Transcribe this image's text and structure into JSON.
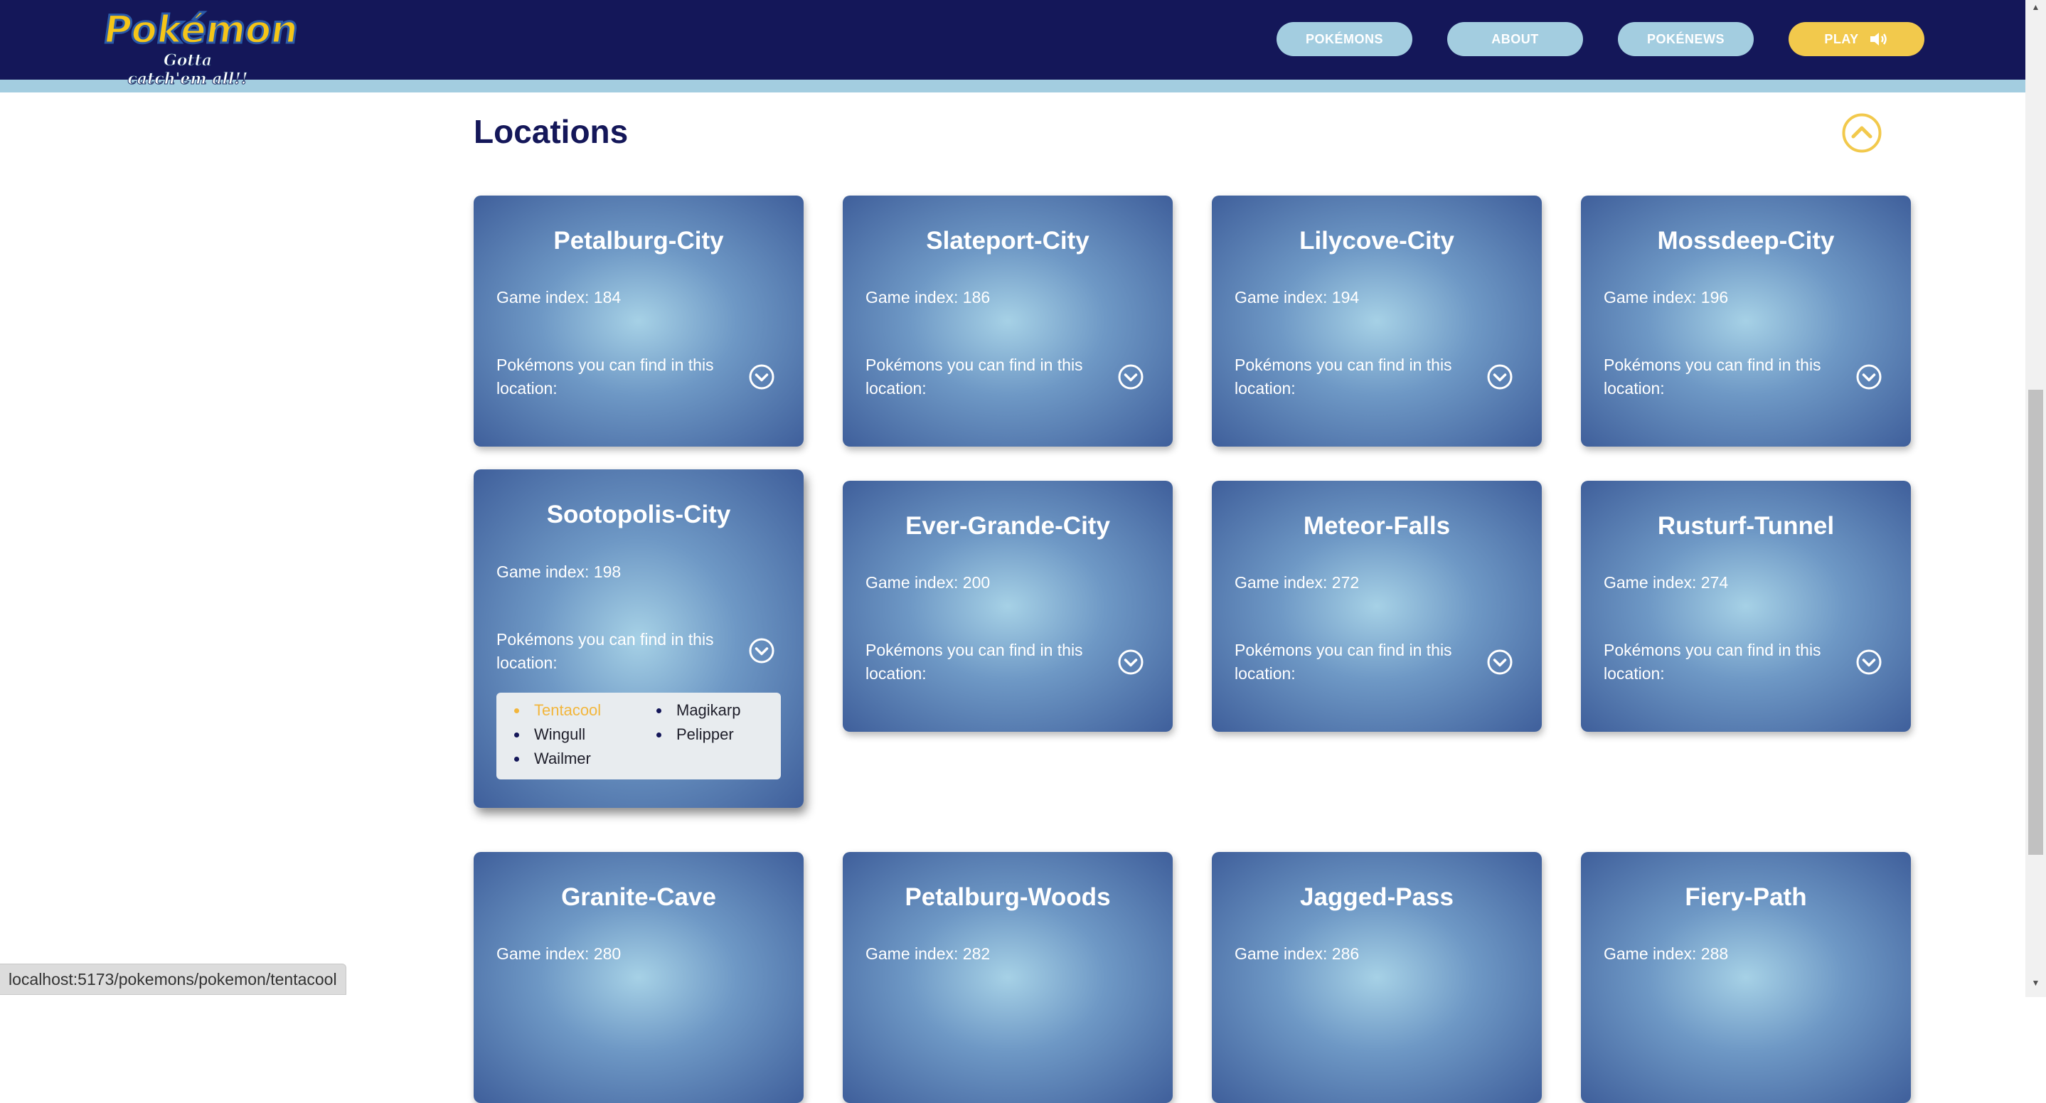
{
  "header": {
    "logo": {
      "wordmark": "Pokémon",
      "tagline": "Gotta catch'em all!!"
    },
    "nav": [
      {
        "label": "POKÉMONS"
      },
      {
        "label": "ABOUT"
      },
      {
        "label": "POKÉNEWS"
      },
      {
        "label": "PLAY",
        "icon": "speaker-icon"
      }
    ]
  },
  "section": {
    "title": "Locations"
  },
  "cards": [
    {
      "name": "Petalburg-City",
      "game_index": "Game index: 184",
      "find_text": "Pokémons you can find in this location:"
    },
    {
      "name": "Slateport-City",
      "game_index": "Game index: 186",
      "find_text": "Pokémons you can find in this location:"
    },
    {
      "name": "Lilycove-City",
      "game_index": "Game index: 194",
      "find_text": "Pokémons you can find in this location:"
    },
    {
      "name": "Mossdeep-City",
      "game_index": "Game index: 196",
      "find_text": "Pokémons you can find in this location:"
    },
    {
      "name": "Sootopolis-City",
      "game_index": "Game index: 198",
      "find_text": "Pokémons you can find in this location:",
      "expanded": true,
      "pokemons": [
        "Tentacool",
        "Magikarp",
        "Wingull",
        "Pelipper",
        "Wailmer"
      ]
    },
    {
      "name": "Ever-Grande-City",
      "game_index": "Game index: 200",
      "find_text": "Pokémons you can find in this location:"
    },
    {
      "name": "Meteor-Falls",
      "game_index": "Game index: 272",
      "find_text": "Pokémons you can find in this location:"
    },
    {
      "name": "Rusturf-Tunnel",
      "game_index": "Game index: 274",
      "find_text": "Pokémons you can find in this location:"
    },
    {
      "name": "Granite-Cave",
      "game_index": "Game index: 280"
    },
    {
      "name": "Petalburg-Woods",
      "game_index": "Game index: 282"
    },
    {
      "name": "Jagged-Pass",
      "game_index": "Game index: 286"
    },
    {
      "name": "Fiery-Path",
      "game_index": "Game index: 288"
    }
  ],
  "status_bar": {
    "url": "localhost:5173/pokemons/pokemon/tentacool"
  },
  "colors": {
    "header_bg": "#141759",
    "nav_button": "#a3cde0",
    "play_button": "#f2c94c",
    "accent": "#f2b63c",
    "title": "#141759"
  }
}
